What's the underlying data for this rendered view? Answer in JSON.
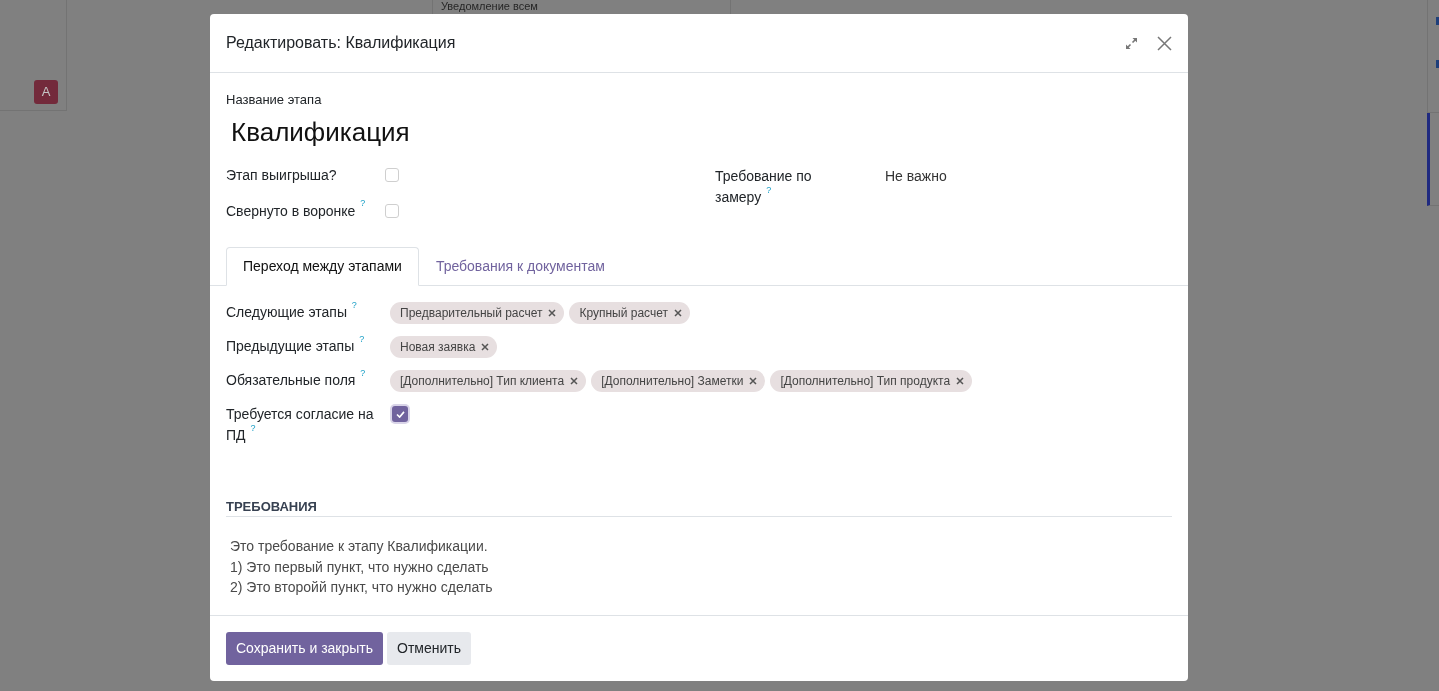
{
  "background": {
    "column_text": "Уведомление всем",
    "avatar_letter": "A"
  },
  "dialog": {
    "title": "Редактировать: Квалификация"
  },
  "name_field": {
    "label": "Название этапа",
    "value": "Квалификация"
  },
  "left_fields": [
    {
      "kind": "checkbox",
      "label": "Этап выигрыша?",
      "checked": false
    },
    {
      "kind": "checkbox",
      "label": "Свернуто в воронке",
      "help": "?",
      "checked": false
    }
  ],
  "right_fields": [
    {
      "kind": "text",
      "label": "Требование по замеру",
      "help": "?",
      "value": "Не важно"
    }
  ],
  "tabs": [
    {
      "label": "Переход между этапами",
      "selected": true
    },
    {
      "label": "Требования к документам",
      "selected": false
    }
  ],
  "tab_fields": [
    {
      "kind": "tags",
      "label": "Следующие этапы",
      "help": "?",
      "tags": [
        "Предварительный расчет",
        "Крупный расчет"
      ]
    },
    {
      "kind": "tags",
      "label": "Предыдущие этапы",
      "help": "?",
      "tags": [
        "Новая заявка"
      ]
    },
    {
      "kind": "tags",
      "label": "Обязательные поля",
      "help": "?",
      "tags": [
        "[Дополнительно] Тип клиента",
        "[Дополнительно] Заметки",
        "[Дополнительно] Тип продукта"
      ]
    },
    {
      "kind": "checkbox",
      "label": "Требуется согласие на ПД",
      "help": "?",
      "checked": true
    }
  ],
  "section": {
    "title": "ТРЕБОВАНИЯ",
    "lines": [
      "Это требование к этапу Квалификации.",
      "1) Это первый пункт, что нужно сделать",
      "2) Это второйй пункт, что нужно сделать"
    ]
  },
  "buttons": [
    {
      "kind": "primary",
      "label": "Сохранить и закрыть"
    },
    {
      "kind": "secondary",
      "label": "Отменить"
    }
  ]
}
